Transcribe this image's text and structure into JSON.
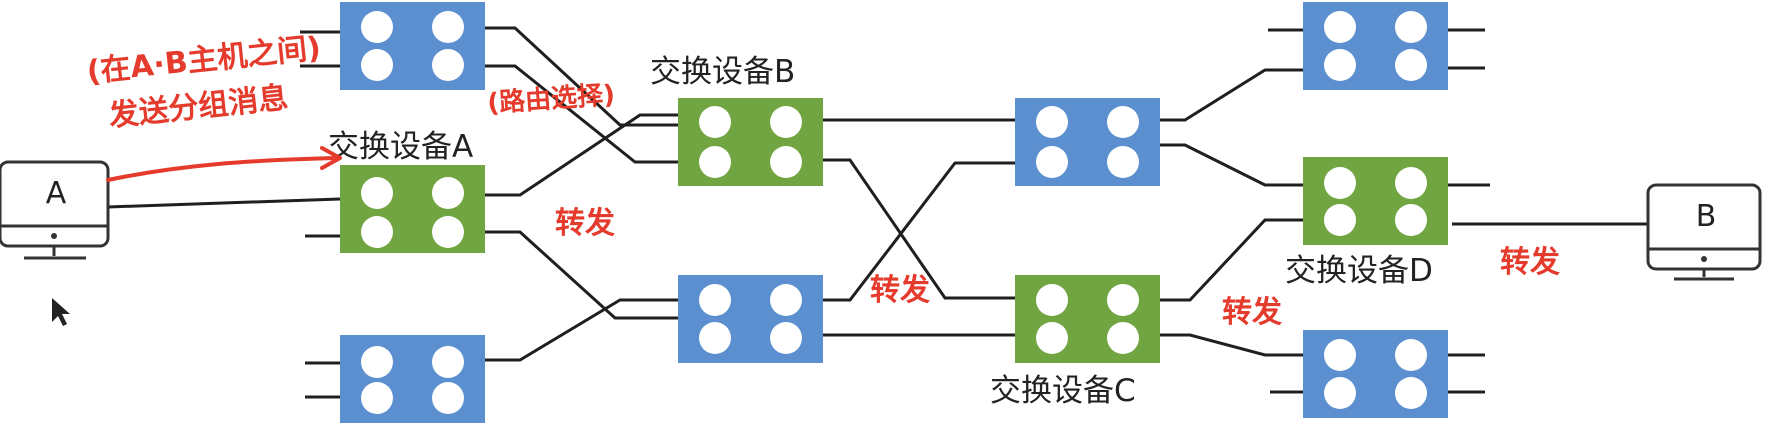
{
  "labels": {
    "switch_a": "交换设备A",
    "switch_b": "交换设备B",
    "switch_c": "交换设备C",
    "switch_d": "交换设备D"
  },
  "hosts": {
    "a": "A",
    "b": "B"
  },
  "annotations": {
    "line1": "(在A·B主机之间)",
    "line2": "发送分组消息",
    "route_select": "(路由选择)",
    "forward_1": "转发",
    "forward_2": "转发",
    "forward_3": "转发",
    "forward_4": "转发"
  },
  "colors": {
    "switch_green": "#71a541",
    "switch_blue": "#5b8fd0",
    "port_white": "#ffffff",
    "link": "#1f1f1f",
    "annotation_red": "#e53b2c",
    "host_outline": "#333333"
  },
  "icons": {
    "cursor": "mouse-pointer-icon",
    "host": "monitor-icon"
  }
}
